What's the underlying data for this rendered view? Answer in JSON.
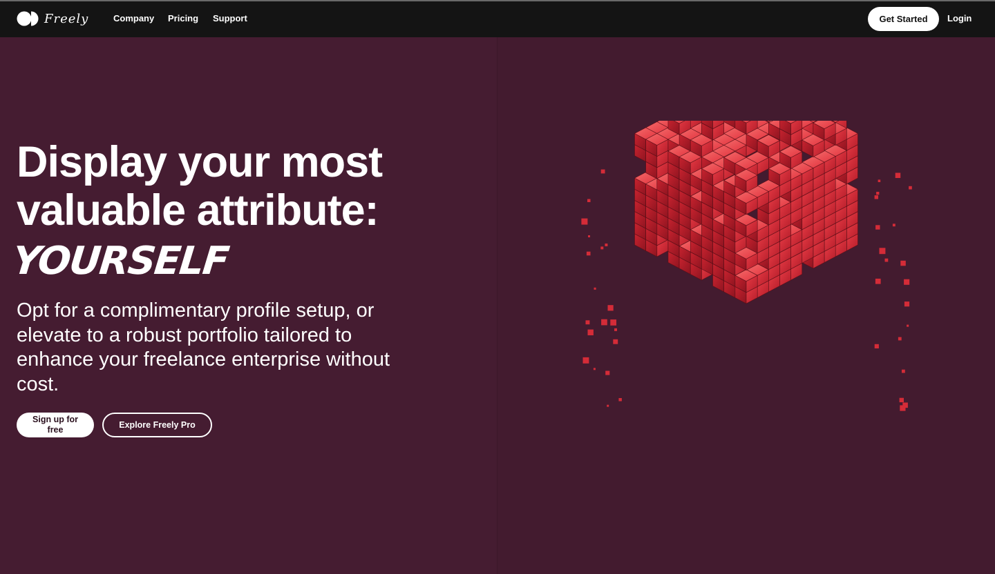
{
  "brand": {
    "name": "Freely"
  },
  "nav": {
    "links": [
      "Company",
      "Pricing",
      "Support"
    ],
    "get_started": "Get Started",
    "login": "Login"
  },
  "hero": {
    "headline_line1": "Display your most",
    "headline_line2": "valuable attribute:",
    "script_word": "YOURSELF",
    "subtext": "Opt for a complimentary profile setup, or elevate to a robust portfolio tailored to enhance your freelance enterprise without cost.",
    "cta_primary": "Sign up for free",
    "cta_secondary": "Explore Freely Pro"
  },
  "colors": {
    "nav_bg": "#141414",
    "page_bg": "#451c31",
    "accent_red": "#e2343f"
  },
  "icons": {
    "logo_mark": "two-circles-logo-icon"
  }
}
